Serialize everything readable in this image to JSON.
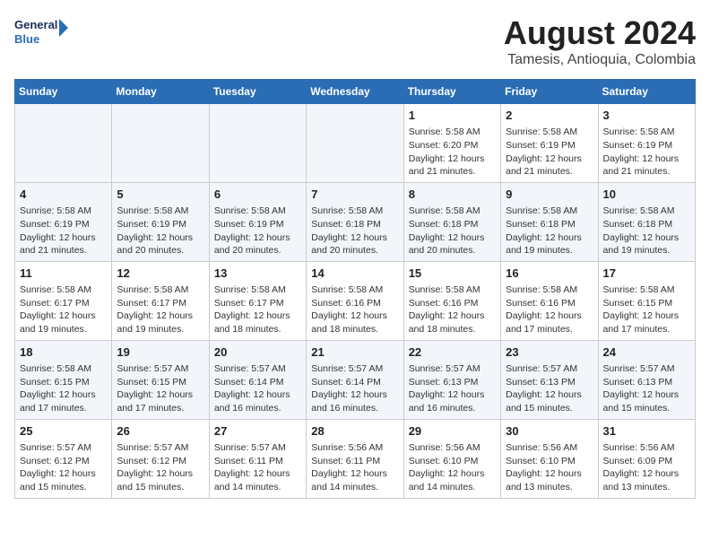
{
  "header": {
    "logo_line1": "General",
    "logo_line2": "Blue",
    "main_title": "August 2024",
    "sub_title": "Tamesis, Antioquia, Colombia"
  },
  "weekdays": [
    "Sunday",
    "Monday",
    "Tuesday",
    "Wednesday",
    "Thursday",
    "Friday",
    "Saturday"
  ],
  "weeks": [
    [
      {
        "day": "",
        "data": ""
      },
      {
        "day": "",
        "data": ""
      },
      {
        "day": "",
        "data": ""
      },
      {
        "day": "",
        "data": ""
      },
      {
        "day": "1",
        "data": "Sunrise: 5:58 AM\nSunset: 6:20 PM\nDaylight: 12 hours\nand 21 minutes."
      },
      {
        "day": "2",
        "data": "Sunrise: 5:58 AM\nSunset: 6:19 PM\nDaylight: 12 hours\nand 21 minutes."
      },
      {
        "day": "3",
        "data": "Sunrise: 5:58 AM\nSunset: 6:19 PM\nDaylight: 12 hours\nand 21 minutes."
      }
    ],
    [
      {
        "day": "4",
        "data": "Sunrise: 5:58 AM\nSunset: 6:19 PM\nDaylight: 12 hours\nand 21 minutes."
      },
      {
        "day": "5",
        "data": "Sunrise: 5:58 AM\nSunset: 6:19 PM\nDaylight: 12 hours\nand 20 minutes."
      },
      {
        "day": "6",
        "data": "Sunrise: 5:58 AM\nSunset: 6:19 PM\nDaylight: 12 hours\nand 20 minutes."
      },
      {
        "day": "7",
        "data": "Sunrise: 5:58 AM\nSunset: 6:18 PM\nDaylight: 12 hours\nand 20 minutes."
      },
      {
        "day": "8",
        "data": "Sunrise: 5:58 AM\nSunset: 6:18 PM\nDaylight: 12 hours\nand 20 minutes."
      },
      {
        "day": "9",
        "data": "Sunrise: 5:58 AM\nSunset: 6:18 PM\nDaylight: 12 hours\nand 19 minutes."
      },
      {
        "day": "10",
        "data": "Sunrise: 5:58 AM\nSunset: 6:18 PM\nDaylight: 12 hours\nand 19 minutes."
      }
    ],
    [
      {
        "day": "11",
        "data": "Sunrise: 5:58 AM\nSunset: 6:17 PM\nDaylight: 12 hours\nand 19 minutes."
      },
      {
        "day": "12",
        "data": "Sunrise: 5:58 AM\nSunset: 6:17 PM\nDaylight: 12 hours\nand 19 minutes."
      },
      {
        "day": "13",
        "data": "Sunrise: 5:58 AM\nSunset: 6:17 PM\nDaylight: 12 hours\nand 18 minutes."
      },
      {
        "day": "14",
        "data": "Sunrise: 5:58 AM\nSunset: 6:16 PM\nDaylight: 12 hours\nand 18 minutes."
      },
      {
        "day": "15",
        "data": "Sunrise: 5:58 AM\nSunset: 6:16 PM\nDaylight: 12 hours\nand 18 minutes."
      },
      {
        "day": "16",
        "data": "Sunrise: 5:58 AM\nSunset: 6:16 PM\nDaylight: 12 hours\nand 17 minutes."
      },
      {
        "day": "17",
        "data": "Sunrise: 5:58 AM\nSunset: 6:15 PM\nDaylight: 12 hours\nand 17 minutes."
      }
    ],
    [
      {
        "day": "18",
        "data": "Sunrise: 5:58 AM\nSunset: 6:15 PM\nDaylight: 12 hours\nand 17 minutes."
      },
      {
        "day": "19",
        "data": "Sunrise: 5:57 AM\nSunset: 6:15 PM\nDaylight: 12 hours\nand 17 minutes."
      },
      {
        "day": "20",
        "data": "Sunrise: 5:57 AM\nSunset: 6:14 PM\nDaylight: 12 hours\nand 16 minutes."
      },
      {
        "day": "21",
        "data": "Sunrise: 5:57 AM\nSunset: 6:14 PM\nDaylight: 12 hours\nand 16 minutes."
      },
      {
        "day": "22",
        "data": "Sunrise: 5:57 AM\nSunset: 6:13 PM\nDaylight: 12 hours\nand 16 minutes."
      },
      {
        "day": "23",
        "data": "Sunrise: 5:57 AM\nSunset: 6:13 PM\nDaylight: 12 hours\nand 15 minutes."
      },
      {
        "day": "24",
        "data": "Sunrise: 5:57 AM\nSunset: 6:13 PM\nDaylight: 12 hours\nand 15 minutes."
      }
    ],
    [
      {
        "day": "25",
        "data": "Sunrise: 5:57 AM\nSunset: 6:12 PM\nDaylight: 12 hours\nand 15 minutes."
      },
      {
        "day": "26",
        "data": "Sunrise: 5:57 AM\nSunset: 6:12 PM\nDaylight: 12 hours\nand 15 minutes."
      },
      {
        "day": "27",
        "data": "Sunrise: 5:57 AM\nSunset: 6:11 PM\nDaylight: 12 hours\nand 14 minutes."
      },
      {
        "day": "28",
        "data": "Sunrise: 5:56 AM\nSunset: 6:11 PM\nDaylight: 12 hours\nand 14 minutes."
      },
      {
        "day": "29",
        "data": "Sunrise: 5:56 AM\nSunset: 6:10 PM\nDaylight: 12 hours\nand 14 minutes."
      },
      {
        "day": "30",
        "data": "Sunrise: 5:56 AM\nSunset: 6:10 PM\nDaylight: 12 hours\nand 13 minutes."
      },
      {
        "day": "31",
        "data": "Sunrise: 5:56 AM\nSunset: 6:09 PM\nDaylight: 12 hours\nand 13 minutes."
      }
    ]
  ]
}
